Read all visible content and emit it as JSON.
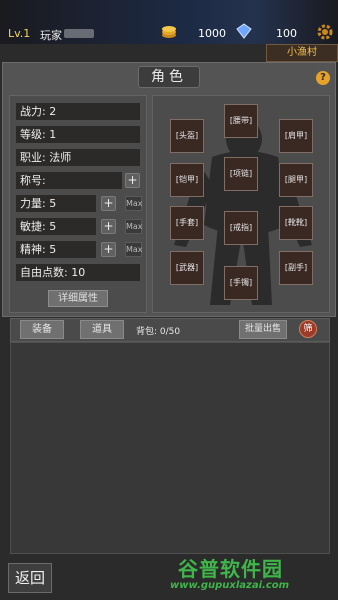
{
  "topbar": {
    "level": "Lv.1",
    "player_name": "玩家",
    "gold": "1000",
    "gems": "100",
    "location": "小渔村"
  },
  "panel": {
    "title": "角色",
    "help": "?"
  },
  "stats": {
    "power": "战力: 2",
    "level": "等级: 1",
    "class": "职业: 法师",
    "title": "称号:",
    "strength": "力量: 5",
    "agility": "敏捷: 5",
    "spirit": "精神: 5",
    "free_points": "自由点数: 10",
    "plus": "+",
    "max": "Max",
    "detail_button": "详细属性"
  },
  "equipment": {
    "helmet": "[头盔]",
    "cape": "[腰带]",
    "shoulder": "[肩甲]",
    "armor": "[铠甲]",
    "necklace": "[项链]",
    "leg": "[腿甲]",
    "gloves": "[手套]",
    "ring": "[戒指]",
    "boots": "[靴靴]",
    "weapon": "[武器]",
    "bracelet": "[手镯]",
    "offhand": "[副手]"
  },
  "inventory": {
    "tab_equip": "装备",
    "tab_items": "道具",
    "bag_count": "背包: 0/50",
    "batch_sell": "批量出售",
    "filter": "筛"
  },
  "footer": {
    "back": "返回",
    "watermark_cn": "谷普软件园",
    "watermark_url": "www.gupuxlazai.com"
  },
  "colors": {
    "accent_gold": "#f2c04a",
    "slot_bg": "#3a2823",
    "watermark_green": "#3fb54a"
  }
}
